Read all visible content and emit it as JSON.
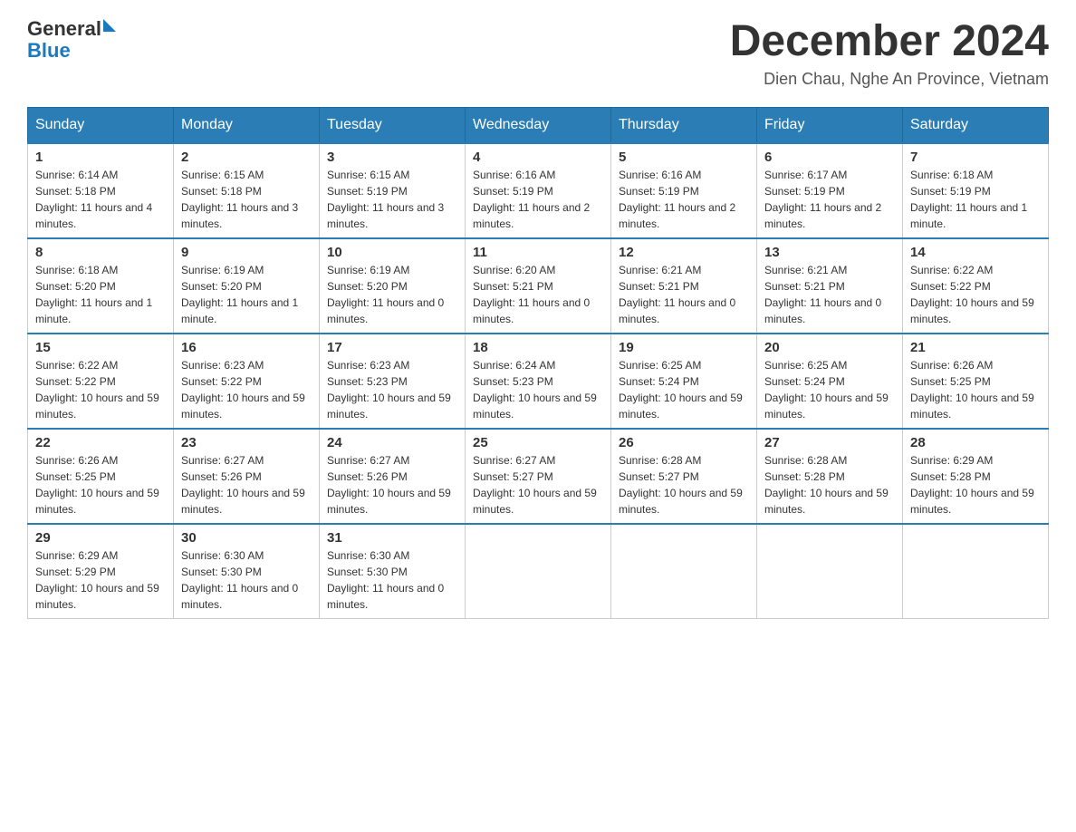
{
  "header": {
    "logo_general": "General",
    "logo_blue": "Blue",
    "month_title": "December 2024",
    "location": "Dien Chau, Nghe An Province, Vietnam"
  },
  "weekdays": [
    "Sunday",
    "Monday",
    "Tuesday",
    "Wednesday",
    "Thursday",
    "Friday",
    "Saturday"
  ],
  "weeks": [
    [
      {
        "day": "1",
        "sunrise": "6:14 AM",
        "sunset": "5:18 PM",
        "daylight": "11 hours and 4 minutes."
      },
      {
        "day": "2",
        "sunrise": "6:15 AM",
        "sunset": "5:18 PM",
        "daylight": "11 hours and 3 minutes."
      },
      {
        "day": "3",
        "sunrise": "6:15 AM",
        "sunset": "5:19 PM",
        "daylight": "11 hours and 3 minutes."
      },
      {
        "day": "4",
        "sunrise": "6:16 AM",
        "sunset": "5:19 PM",
        "daylight": "11 hours and 2 minutes."
      },
      {
        "day": "5",
        "sunrise": "6:16 AM",
        "sunset": "5:19 PM",
        "daylight": "11 hours and 2 minutes."
      },
      {
        "day": "6",
        "sunrise": "6:17 AM",
        "sunset": "5:19 PM",
        "daylight": "11 hours and 2 minutes."
      },
      {
        "day": "7",
        "sunrise": "6:18 AM",
        "sunset": "5:19 PM",
        "daylight": "11 hours and 1 minute."
      }
    ],
    [
      {
        "day": "8",
        "sunrise": "6:18 AM",
        "sunset": "5:20 PM",
        "daylight": "11 hours and 1 minute."
      },
      {
        "day": "9",
        "sunrise": "6:19 AM",
        "sunset": "5:20 PM",
        "daylight": "11 hours and 1 minute."
      },
      {
        "day": "10",
        "sunrise": "6:19 AM",
        "sunset": "5:20 PM",
        "daylight": "11 hours and 0 minutes."
      },
      {
        "day": "11",
        "sunrise": "6:20 AM",
        "sunset": "5:21 PM",
        "daylight": "11 hours and 0 minutes."
      },
      {
        "day": "12",
        "sunrise": "6:21 AM",
        "sunset": "5:21 PM",
        "daylight": "11 hours and 0 minutes."
      },
      {
        "day": "13",
        "sunrise": "6:21 AM",
        "sunset": "5:21 PM",
        "daylight": "11 hours and 0 minutes."
      },
      {
        "day": "14",
        "sunrise": "6:22 AM",
        "sunset": "5:22 PM",
        "daylight": "10 hours and 59 minutes."
      }
    ],
    [
      {
        "day": "15",
        "sunrise": "6:22 AM",
        "sunset": "5:22 PM",
        "daylight": "10 hours and 59 minutes."
      },
      {
        "day": "16",
        "sunrise": "6:23 AM",
        "sunset": "5:22 PM",
        "daylight": "10 hours and 59 minutes."
      },
      {
        "day": "17",
        "sunrise": "6:23 AM",
        "sunset": "5:23 PM",
        "daylight": "10 hours and 59 minutes."
      },
      {
        "day": "18",
        "sunrise": "6:24 AM",
        "sunset": "5:23 PM",
        "daylight": "10 hours and 59 minutes."
      },
      {
        "day": "19",
        "sunrise": "6:25 AM",
        "sunset": "5:24 PM",
        "daylight": "10 hours and 59 minutes."
      },
      {
        "day": "20",
        "sunrise": "6:25 AM",
        "sunset": "5:24 PM",
        "daylight": "10 hours and 59 minutes."
      },
      {
        "day": "21",
        "sunrise": "6:26 AM",
        "sunset": "5:25 PM",
        "daylight": "10 hours and 59 minutes."
      }
    ],
    [
      {
        "day": "22",
        "sunrise": "6:26 AM",
        "sunset": "5:25 PM",
        "daylight": "10 hours and 59 minutes."
      },
      {
        "day": "23",
        "sunrise": "6:27 AM",
        "sunset": "5:26 PM",
        "daylight": "10 hours and 59 minutes."
      },
      {
        "day": "24",
        "sunrise": "6:27 AM",
        "sunset": "5:26 PM",
        "daylight": "10 hours and 59 minutes."
      },
      {
        "day": "25",
        "sunrise": "6:27 AM",
        "sunset": "5:27 PM",
        "daylight": "10 hours and 59 minutes."
      },
      {
        "day": "26",
        "sunrise": "6:28 AM",
        "sunset": "5:27 PM",
        "daylight": "10 hours and 59 minutes."
      },
      {
        "day": "27",
        "sunrise": "6:28 AM",
        "sunset": "5:28 PM",
        "daylight": "10 hours and 59 minutes."
      },
      {
        "day": "28",
        "sunrise": "6:29 AM",
        "sunset": "5:28 PM",
        "daylight": "10 hours and 59 minutes."
      }
    ],
    [
      {
        "day": "29",
        "sunrise": "6:29 AM",
        "sunset": "5:29 PM",
        "daylight": "10 hours and 59 minutes."
      },
      {
        "day": "30",
        "sunrise": "6:30 AM",
        "sunset": "5:30 PM",
        "daylight": "11 hours and 0 minutes."
      },
      {
        "day": "31",
        "sunrise": "6:30 AM",
        "sunset": "5:30 PM",
        "daylight": "11 hours and 0 minutes."
      },
      null,
      null,
      null,
      null
    ]
  ],
  "labels": {
    "sunrise": "Sunrise:",
    "sunset": "Sunset:",
    "daylight": "Daylight:"
  }
}
